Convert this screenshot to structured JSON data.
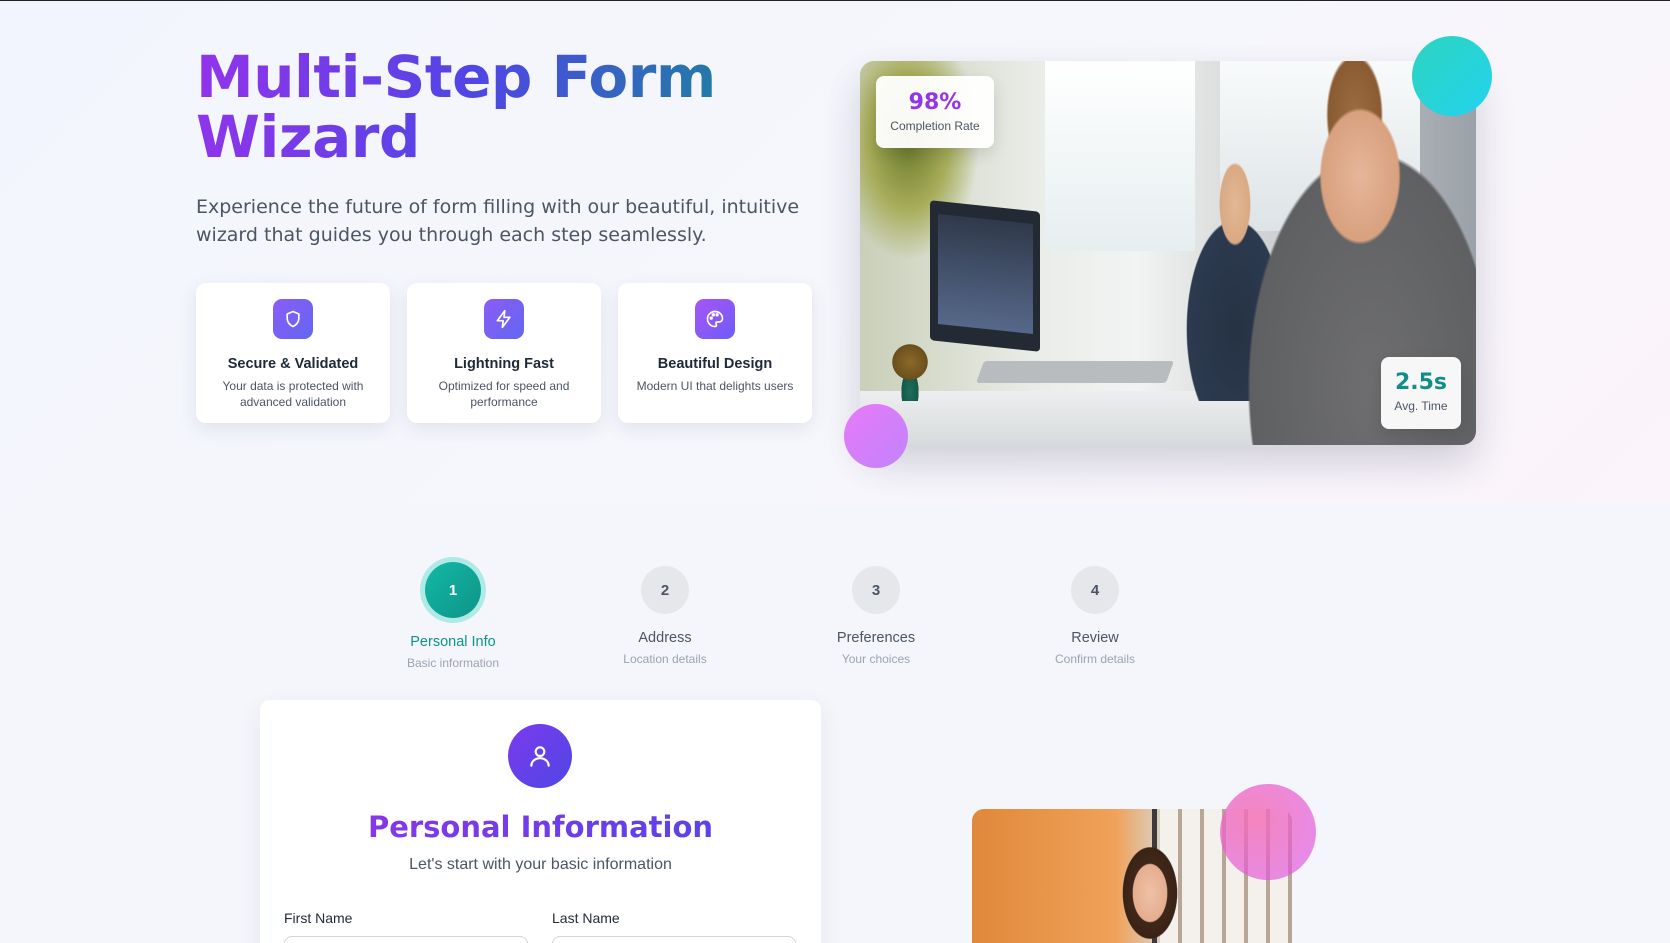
{
  "hero": {
    "title": "Multi-Step Form Wizard",
    "subtitle": "Experience the future of form filling with our beautiful, intuitive wizard that guides you through each step seamlessly.",
    "features": [
      {
        "icon": "shield-icon",
        "title": "Secure & Validated",
        "desc": "Your data is protected with advanced validation"
      },
      {
        "icon": "lightning-icon",
        "title": "Lightning Fast",
        "desc": "Optimized for speed and performance"
      },
      {
        "icon": "palette-icon",
        "title": "Beautiful Design",
        "desc": "Modern UI that delights users"
      }
    ],
    "stats": [
      {
        "value": "98%",
        "label": "Completion Rate"
      },
      {
        "value": "2.5s",
        "label": "Avg. Time"
      }
    ]
  },
  "steps": [
    {
      "number": "1",
      "label": "Personal Info",
      "sub": "Basic information",
      "active": true
    },
    {
      "number": "2",
      "label": "Address",
      "sub": "Location details",
      "active": false
    },
    {
      "number": "3",
      "label": "Preferences",
      "sub": "Your choices",
      "active": false
    },
    {
      "number": "4",
      "label": "Review",
      "sub": "Confirm details",
      "active": false
    }
  ],
  "form": {
    "icon": "user-icon",
    "title": "Personal Information",
    "subtitle": "Let's start with your basic information",
    "fields": [
      {
        "label": "First Name",
        "value": ""
      },
      {
        "label": "Last Name",
        "value": ""
      }
    ]
  },
  "colors": {
    "accent_teal": "#0d9488",
    "accent_purple": "#9333ea",
    "accent_indigo": "#4f46e5"
  }
}
